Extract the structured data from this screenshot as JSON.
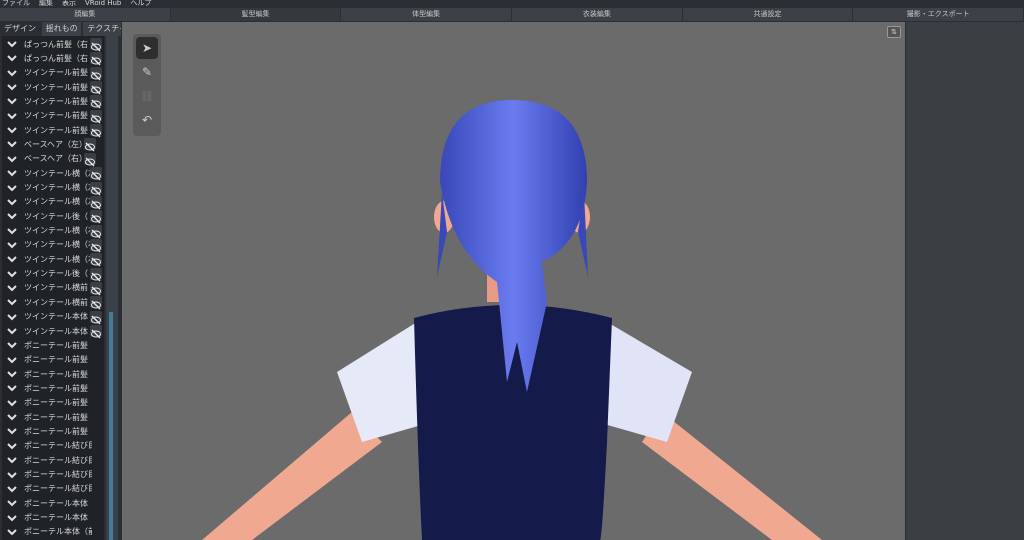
{
  "menu": [
    "ファイル",
    "編集",
    "表示",
    "VRoid Hub",
    "ヘルプ"
  ],
  "main_tabs": [
    "顔編集",
    "髪型編集",
    "体型編集",
    "衣装編集",
    "共通設定",
    "撮影・エクスポート"
  ],
  "active_main_tab": 1,
  "sub_tabs": [
    "デザイン",
    "揺れもの",
    "テクスチャ"
  ],
  "hair_list": [
    {
      "label": "ぱっつん前髪（右",
      "eye": true
    },
    {
      "label": "ぱっつん前髪（右",
      "eye": true
    },
    {
      "label": "ツインテール前髪（",
      "eye": true
    },
    {
      "label": "ツインテール前髪（",
      "eye": true
    },
    {
      "label": "ツインテール前髪（",
      "eye": true
    },
    {
      "label": "ツインテール前髪（",
      "eye": true
    },
    {
      "label": "ツインテール前髪（",
      "eye": true
    },
    {
      "label": "ベースヘア（左）",
      "eye": true
    },
    {
      "label": "ベースヘア（右）",
      "eye": true
    },
    {
      "label": "ツインテール横（左",
      "eye": true
    },
    {
      "label": "ツインテール横（左",
      "eye": true
    },
    {
      "label": "ツインテール横（左",
      "eye": true
    },
    {
      "label": "ツインテール後（",
      "eye": true
    },
    {
      "label": "ツインテール横（右",
      "eye": true
    },
    {
      "label": "ツインテール横（右",
      "eye": true
    },
    {
      "label": "ツインテール横（右",
      "eye": true
    },
    {
      "label": "ツインテール後（",
      "eye": true
    },
    {
      "label": "ツインテール横前（",
      "eye": true
    },
    {
      "label": "ツインテール横前（",
      "eye": true
    },
    {
      "label": "ツインテール本体（",
      "eye": true
    },
    {
      "label": "ツインテール本体（",
      "eye": true
    },
    {
      "label": "ポニーテール前髪（前）",
      "eye": false
    },
    {
      "label": "ポニーテール前髪（左前",
      "eye": false
    },
    {
      "label": "ポニーテール前髪（右前",
      "eye": false
    },
    {
      "label": "ポニーテール前髪（左中",
      "eye": false
    },
    {
      "label": "ポニーテール前髪（右中",
      "eye": false
    },
    {
      "label": "ポニーテール前髪（左後",
      "eye": false
    },
    {
      "label": "ポニーテール前髪（右後",
      "eye": false
    },
    {
      "label": "ポニーテール結び目（前",
      "eye": false
    },
    {
      "label": "ポニーテール結び目（後",
      "eye": false
    },
    {
      "label": "ポニーテール結び目（左",
      "eye": false
    },
    {
      "label": "ポニーテール結び目（右",
      "eye": false
    },
    {
      "label": "ポニーテール本体（中）",
      "eye": false
    },
    {
      "label": "ポニーテール本体（後）",
      "eye": false
    },
    {
      "label": "ポニーテル本体（前）",
      "eye": false
    }
  ],
  "corner_button": "⇅",
  "colors": {
    "hair": "#4a5ad8",
    "vest": "#141a4a",
    "shirt": "#e8ecf8",
    "skin": "#f2a890",
    "viewport": "#6b6b6b"
  }
}
